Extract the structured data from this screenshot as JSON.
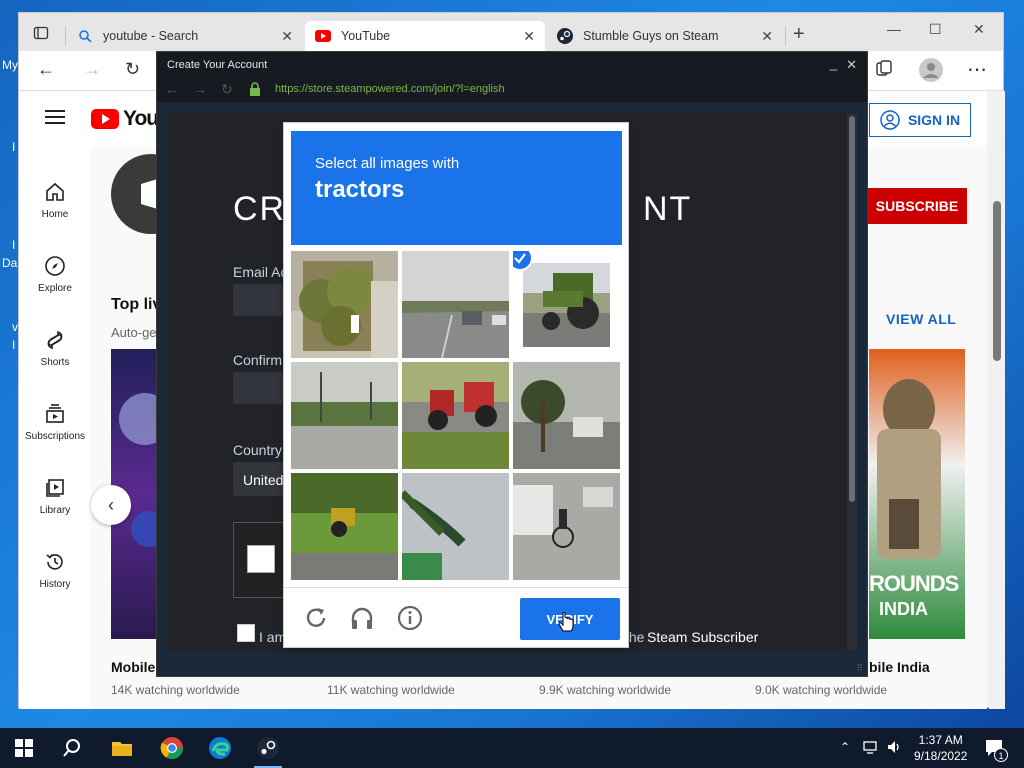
{
  "desktop": {
    "fragments": [
      "My",
      "I",
      "I",
      "Da",
      "v",
      "I"
    ]
  },
  "browser": {
    "tabs": [
      {
        "label": "youtube - Search",
        "icon": "search-icon"
      },
      {
        "label": "YouTube",
        "icon": "youtube-icon"
      },
      {
        "label": "Stumble Guys on Steam",
        "icon": "steam-icon"
      }
    ],
    "new_tab": "+"
  },
  "youtube": {
    "logo_text": "YouTu",
    "sidebar": [
      {
        "label": "Home",
        "icon": "home-icon"
      },
      {
        "label": "Explore",
        "icon": "compass-icon"
      },
      {
        "label": "Shorts",
        "icon": "shorts-icon"
      },
      {
        "label": "Subscriptions",
        "icon": "subscriptions-icon"
      },
      {
        "label": "Library",
        "icon": "library-icon"
      },
      {
        "label": "History",
        "icon": "history-icon"
      }
    ],
    "sign_in": "SIGN IN",
    "subscribe": "SUBSCRIBE",
    "section_title": "Top liv",
    "section_sub": "Auto-ge",
    "view_all": "VIEW ALL",
    "videos": [
      {
        "title": "Mobile",
        "meta": "14K watching worldwide"
      },
      {
        "title": "",
        "meta": "11K watching worldwide"
      },
      {
        "title": "",
        "meta": "9.9K watching worldwide"
      },
      {
        "title": "bile India",
        "meta": "9.0K watching worldwide"
      }
    ],
    "thumb_text_1": "ROUNDS",
    "thumb_text_2": "INDIA"
  },
  "steam": {
    "window_title": "Create Your Account",
    "url": "https://store.steampowered.com/join/?l=english",
    "heading_left": "CRI",
    "heading_right": "NT",
    "email_label": "Email Ac",
    "confirm_label": "Confirm",
    "country_label": "Country",
    "country_value": "United",
    "agree_prefix": "I am",
    "agree_suffix": "the",
    "agree_bold": "Steam Subscriber"
  },
  "captcha": {
    "instruction": "Select all images with",
    "target": "tractors",
    "verify": "VERIFY",
    "tiles": [
      {
        "name": "tile-building",
        "selected": false
      },
      {
        "name": "tile-highway",
        "selected": false
      },
      {
        "name": "tile-tractor-road",
        "selected": true
      },
      {
        "name": "tile-field-road",
        "selected": false
      },
      {
        "name": "tile-red-tractors",
        "selected": false
      },
      {
        "name": "tile-trees-road",
        "selected": false
      },
      {
        "name": "tile-mower-grass",
        "selected": false
      },
      {
        "name": "tile-palm-sign",
        "selected": false
      },
      {
        "name": "tile-cyclist-van",
        "selected": false
      }
    ]
  },
  "taskbar": {
    "time": "1:37 AM",
    "date": "9/18/2022",
    "notification_count": "1",
    "apps": [
      "start-icon",
      "search-icon",
      "file-explorer-icon",
      "chrome-icon",
      "edge-icon",
      "steam-icon"
    ]
  },
  "colors": {
    "captcha_blue": "#1a73e8",
    "yt_red": "#cc0000",
    "steam_bg": "#1b2838",
    "url_green": "#79b84a"
  }
}
